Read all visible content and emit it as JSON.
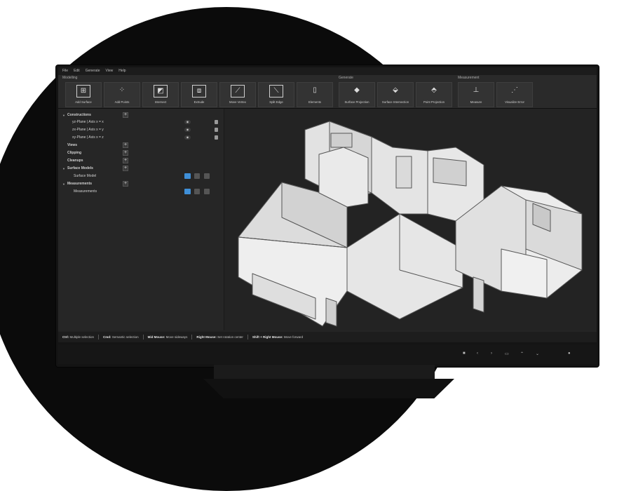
{
  "menu": [
    "File",
    "Edit",
    "Generate",
    "View",
    "Help"
  ],
  "ribbon": {
    "groups": [
      {
        "label": "Modelling"
      },
      {
        "label": "Generate"
      },
      {
        "label": "Measurement"
      }
    ],
    "tools": [
      {
        "label": "Add Surface",
        "icon": "add-surface-icon"
      },
      {
        "label": "Add Points",
        "icon": "add-points-icon"
      },
      {
        "label": "Intersect",
        "icon": "intersect-icon"
      },
      {
        "label": "Extrude",
        "icon": "extrude-icon"
      },
      {
        "label": "Move Vertex",
        "icon": "move-vertex-icon"
      },
      {
        "label": "Split Edge",
        "icon": "split-edge-icon"
      },
      {
        "label": "Elements",
        "icon": "elements-icon"
      },
      {
        "label": "Surface Projection",
        "icon": "surface-projection-icon"
      },
      {
        "label": "Surface Intersection",
        "icon": "surface-intersection-icon"
      },
      {
        "label": "Point Projection",
        "icon": "point-projection-icon"
      },
      {
        "label": "Measure",
        "icon": "measure-icon"
      },
      {
        "label": "Visualize Error",
        "icon": "visualize-error-icon"
      }
    ]
  },
  "tree": {
    "constructions": "Constructions",
    "yz_plane": "yz-Plane | Axis x = x",
    "zx_plane": "zx-Plane | Axis x = y",
    "xy_plane": "xy-Plane | Axis x = z",
    "views": "Views",
    "clipping": "Clipping",
    "cleanups": "Cleanups",
    "surface_models": "Surface Models",
    "surface_model": "Surface Model",
    "measurements": "Measurements",
    "measurements_child": "Measurements"
  },
  "status": [
    {
      "key": "Ctrl:",
      "value": "Multiple selection"
    },
    {
      "key": "Cmd:",
      "value": "Semantic selection"
    },
    {
      "key": "Mid Mouse:",
      "value": "Move sideways"
    },
    {
      "key": "Right Mouse:",
      "value": "Set rotation center"
    },
    {
      "key": "Shift + Right Mouse:",
      "value": "Move forward"
    }
  ],
  "colors": {
    "accent": "#3f8fd8",
    "model_fill": "#e9e9e9",
    "model_stroke": "#555555",
    "background": "#242424"
  }
}
